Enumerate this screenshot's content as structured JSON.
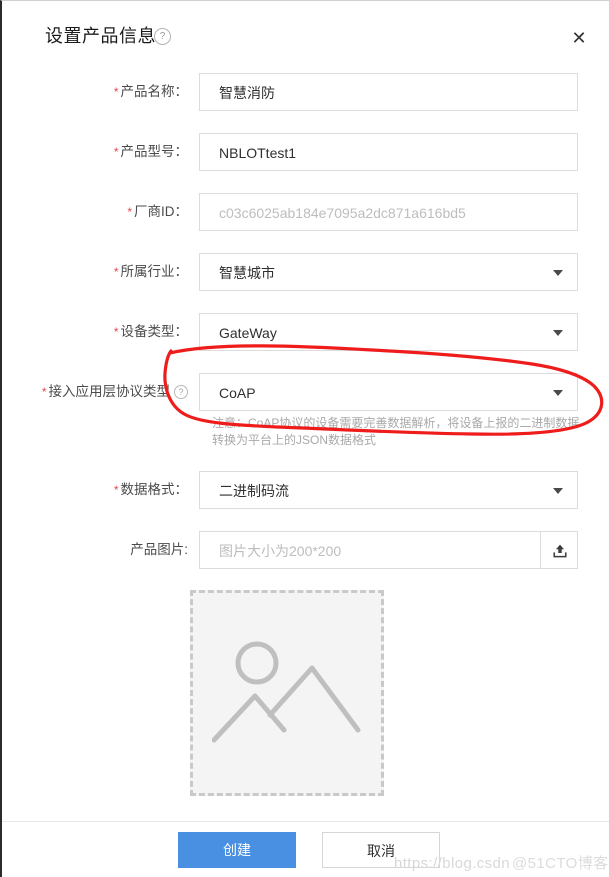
{
  "dialog": {
    "title": "设置产品信息",
    "title_help_icon": "help-circle-icon",
    "close_icon": "✕"
  },
  "form": {
    "fields": [
      {
        "label": "产品名称：",
        "required": true,
        "value": "智慧消防",
        "is_placeholder": false,
        "type": "text",
        "help": false
      },
      {
        "label": "产品型号：",
        "required": true,
        "value": "NBLOTtest1",
        "is_placeholder": false,
        "type": "text",
        "help": false
      },
      {
        "label": "厂商ID：",
        "required": true,
        "value": "c03c6025ab184e7095a2dc871a616bd5",
        "is_placeholder": true,
        "type": "text",
        "help": false
      },
      {
        "label": "所属行业：",
        "required": true,
        "value": "智慧城市",
        "is_placeholder": false,
        "type": "select",
        "help": false
      },
      {
        "label": "设备类型：",
        "required": true,
        "value": "GateWay",
        "is_placeholder": false,
        "type": "select",
        "help": false
      },
      {
        "label": "接入应用层协议类型",
        "required": true,
        "value": "CoAP",
        "is_placeholder": false,
        "type": "select",
        "help": true
      },
      {
        "label": "数据格式：",
        "required": true,
        "value": "二进制码流",
        "is_placeholder": false,
        "type": "select",
        "help": false
      },
      {
        "label": "产品图片:",
        "required": false,
        "value": "图片大小为200*200",
        "is_placeholder": true,
        "type": "upload",
        "help": false
      }
    ],
    "protocol_hint": "注意：CoAP协议的设备需要完善数据解析，将设备上报的二进制数据转换为平台上的JSON数据格式",
    "image_preview_icon": "image-placeholder-icon",
    "upload_icon": "upload-icon"
  },
  "footer": {
    "submit_label": "创建",
    "cancel_label": "取消"
  },
  "watermark": {
    "url": "https://blog.csdn",
    "brand": "@51CTO博客"
  },
  "colors": {
    "primary": "#4a90e2",
    "required_star": "#e24a4a",
    "annotation": "#ef1c1c",
    "border": "#dcdcdc",
    "placeholder_text": "#bdbdbd"
  },
  "annotation": {
    "shape": "hand-drawn-ellipse-highlight",
    "target": "接入应用层协议类型"
  }
}
